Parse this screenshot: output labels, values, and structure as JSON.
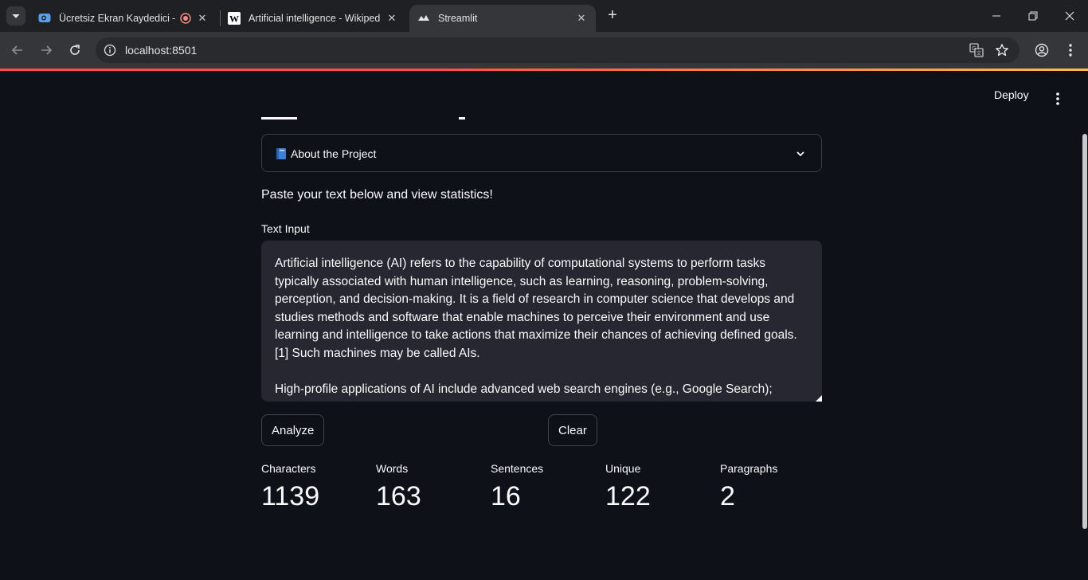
{
  "browser": {
    "tabs": [
      {
        "title": "Ücretsiz Ekran Kaydedici – V",
        "active": false
      },
      {
        "title": "Artificial intelligence - Wikipedia",
        "active": false
      },
      {
        "title": "Streamlit",
        "active": true
      }
    ],
    "url": "localhost:8501"
  },
  "app": {
    "deploy_label": "Deploy",
    "expander_label": "About the Project",
    "intro_text": "Paste your text below and view statistics!",
    "text_input_label": "Text Input",
    "text_input_value": "Artificial intelligence (AI) refers to the capability of computational systems to perform tasks typically associated with human intelligence, such as learning, reasoning, problem-solving, perception, and decision-making. It is a field of research in computer science that develops and studies methods and software that enable machines to perceive their environment and use learning and intelligence to take actions that maximize their chances of achieving defined goals.[1] Such machines may be called AIs.\n\nHigh-profile applications of AI include advanced web search engines (e.g., Google Search);",
    "analyze_label": "Analyze",
    "clear_label": "Clear",
    "metrics": [
      {
        "label": "Characters",
        "value": "1139"
      },
      {
        "label": "Words",
        "value": "163"
      },
      {
        "label": "Sentences",
        "value": "16"
      },
      {
        "label": "Unique",
        "value": "122"
      },
      {
        "label": "Paragraphs",
        "value": "2"
      }
    ]
  },
  "colors": {
    "background": "#0e1117",
    "text": "#fafafa",
    "textarea_bg": "#262730",
    "accent": "#ff4b4b"
  }
}
